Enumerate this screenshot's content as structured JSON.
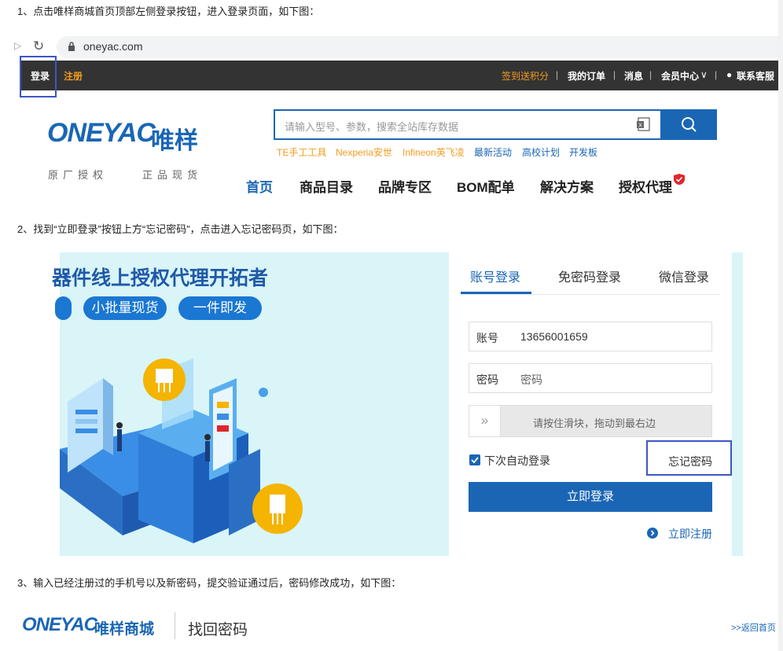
{
  "steps": {
    "s1": "1、点击唯样商城首页顶部左侧登录按钮，进入登录页面，如下图：",
    "s2": "2、找到“立即登录”按钮上方“忘记密码”，点击进入忘记密码页，如下图：",
    "s3": "3、输入已经注册过的手机号以及新密码，提交验证通过后，密码修改成功，如下图："
  },
  "browser": {
    "url": "oneyac.com",
    "icons": [
      "back-icon",
      "reload-icon",
      "lock-icon"
    ]
  },
  "topbar": {
    "login": "登录",
    "register": "注册",
    "checkin": "签到送积分",
    "orders": "我的订单",
    "messages": "消息",
    "member": "会员中心",
    "service": "联系客服",
    "sep": "|"
  },
  "header": {
    "logo_en": "ONEYAC",
    "logo_cn": "唯样",
    "slogan_left": "原厂授权",
    "slogan_right": "正品现货",
    "search_placeholder": "请输入型号、参数，搜索全站库存数据",
    "hot_links": [
      "TE手工工具",
      "Nexperia安世",
      "Infineon英飞凌",
      "最新活动",
      "高校计划",
      "开发板"
    ],
    "nav": [
      "首页",
      "商品目录",
      "品牌专区",
      "BOM配单",
      "解决方案",
      "授权代理"
    ]
  },
  "login_page": {
    "headline": "器件线上授权代理开拓者",
    "pills": [
      "小批量现货",
      "一件即发"
    ],
    "tabs": [
      "账号登录",
      "免密码登录",
      "微信登录"
    ],
    "account_label": "账号",
    "account_value": "13656001659",
    "password_label": "密码",
    "password_placeholder": "密码",
    "slider_knob": "»",
    "slider_text": "请按住滑块，拖动到最右边",
    "remember": "下次自动登录",
    "forgot": "忘记密码",
    "login_button": "立即登录",
    "register_link": "立即注册"
  },
  "footer": {
    "logo_en": "ONEYAC",
    "logo_cn": "唯样商城",
    "title": "找回密码",
    "back_home": ">>返回首页"
  },
  "colors": {
    "brand": "#1a66b5",
    "orange": "#f39c1f",
    "highlight": "#3b57c4",
    "banner_bg": "#d9f5f8"
  }
}
